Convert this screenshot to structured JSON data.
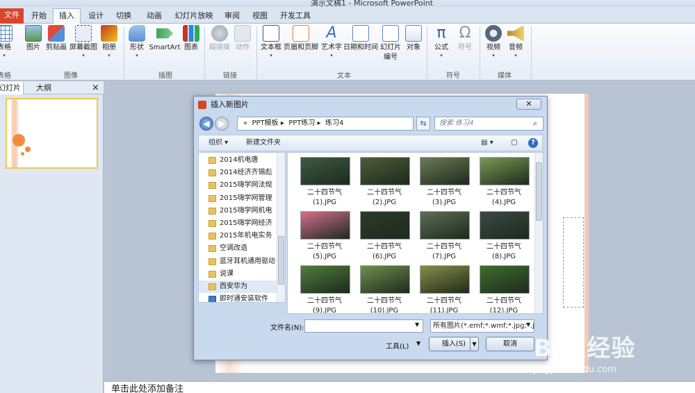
{
  "app": {
    "title": "演示文稿1 - Microsoft PowerPoint"
  },
  "tabs": [
    "文件",
    "开始",
    "插入",
    "设计",
    "切换",
    "动画",
    "幻灯片放映",
    "审阅",
    "视图",
    "开发工具"
  ],
  "ribbon": {
    "buttons": [
      {
        "label": "表格",
        "icon": "table-icon"
      },
      {
        "label": "图片",
        "icon": "picture-icon"
      },
      {
        "label": "剪贴画",
        "icon": "clipart-icon"
      },
      {
        "label": "屏幕截图",
        "icon": "screenshot-icon"
      },
      {
        "label": "相册",
        "icon": "album-icon"
      },
      {
        "label": "形状",
        "icon": "shapes-icon"
      },
      {
        "label": "SmartArt",
        "icon": "smartart-icon"
      },
      {
        "label": "图表",
        "icon": "chart-icon"
      },
      {
        "label": "超链接",
        "icon": "hyperlink-icon"
      },
      {
        "label": "动作",
        "icon": "action-icon"
      },
      {
        "label": "文本框",
        "icon": "textbox-icon"
      },
      {
        "label": "页眉和页脚",
        "icon": "header-footer-icon"
      },
      {
        "label": "艺术字",
        "icon": "wordart-icon"
      },
      {
        "label": "日期和时间",
        "icon": "datetime-icon"
      },
      {
        "label": "幻灯片编号",
        "icon": "slide-number-icon"
      },
      {
        "label": "对象",
        "icon": "object-icon"
      },
      {
        "label": "公式",
        "icon": "equation-icon"
      },
      {
        "label": "符号",
        "icon": "symbol-icon"
      },
      {
        "label": "视频",
        "icon": "video-icon"
      },
      {
        "label": "音频",
        "icon": "audio-icon"
      }
    ],
    "groups": [
      "表格",
      "图像",
      "插图",
      "链接",
      "文本",
      "符号",
      "媒体"
    ]
  },
  "leftpane": {
    "tabs": [
      "幻灯片",
      "大纲"
    ],
    "close": "×"
  },
  "dialog": {
    "title": "插入新图片",
    "close": "✕",
    "address": [
      "«",
      "PPT模板",
      "PPT练习",
      "练习4"
    ],
    "search_placeholder": "搜索 练习4",
    "toolbar": {
      "organize": "组织 ▾",
      "new_folder": "新建文件夹"
    },
    "folders": [
      "2014机电唐",
      "2014经济齐锡彪",
      "2015嗨学网法规",
      "2015嗨学网管理",
      "2015嗨学网机电",
      "2015嗨学网经济",
      "2015年机电实务",
      "空调改造",
      "蓝牙耳机通用驱动",
      "说课",
      "西安华为",
      "即时通安装软件"
    ],
    "files": [
      {
        "name": "二十四节气",
        "ext": "(1).JPG",
        "color": "#3f5a45"
      },
      {
        "name": "二十四节气",
        "ext": "(2).JPG",
        "color": "#4d5c3a"
      },
      {
        "name": "二十四节气",
        "ext": "(3).JPG",
        "color": "#6d7a55"
      },
      {
        "name": "二十四节气",
        "ext": "(4).JPG",
        "color": "#7a9a55"
      },
      {
        "name": "二十四节气",
        "ext": "(5).JPG",
        "color": "#d36f8a"
      },
      {
        "name": "二十四节气",
        "ext": "(6).JPG",
        "color": "#2d3b2a"
      },
      {
        "name": "二十四节气",
        "ext": "(7).JPG",
        "color": "#5d6d52"
      },
      {
        "name": "二十四节气",
        "ext": "(8).JPG",
        "color": "#3a4a44"
      },
      {
        "name": "二十四节气",
        "ext": "(9).JPG",
        "color": "#4f7d3c"
      },
      {
        "name": "二十四节气",
        "ext": "(10).JPG",
        "color": "#6e8f4e"
      },
      {
        "name": "二十四节气",
        "ext": "(11).JPG",
        "color": "#8a8d45"
      },
      {
        "name": "二十四节气",
        "ext": "(12).JPG",
        "color": "#3f6d2f"
      }
    ],
    "filename_label": "文件名(N):",
    "filename_value": "",
    "filetype_value": "所有图片(*.emf;*.wmf;*.jpg;*.jj",
    "tools_label": "工具(L)",
    "insert_label": "插入(S)",
    "cancel_label": "取消"
  },
  "notes": {
    "placeholder": "单击此处添加备注"
  },
  "watermark": {
    "brand": "Bai 经验",
    "url": "jingyan.baidu.com"
  }
}
